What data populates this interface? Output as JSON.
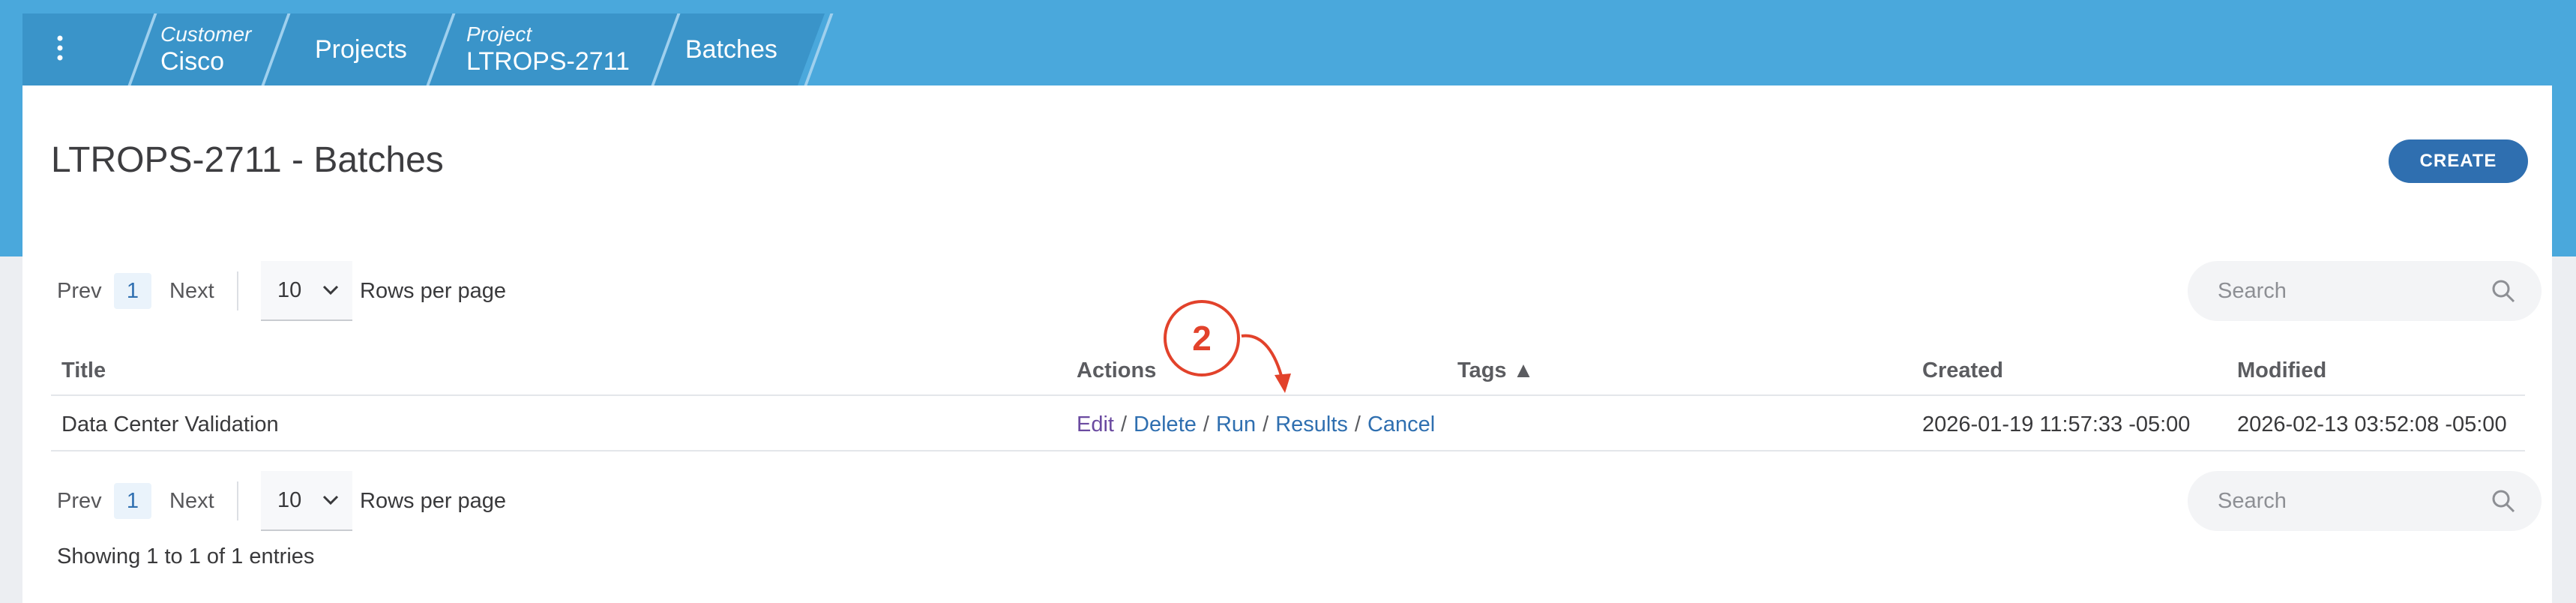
{
  "breadcrumb": {
    "menu_icon": "kebab-icon",
    "customer_label": "Customer",
    "customer_value": "Cisco",
    "projects": "Projects",
    "project_label": "Project",
    "project_value": "LTROPS-2711",
    "batches": "Batches"
  },
  "page": {
    "title": "LTROPS-2711 - Batches",
    "create_label": "CREATE"
  },
  "pager": {
    "prev": "Prev",
    "page": "1",
    "next": "Next",
    "rows_value": "10",
    "rows_label": "Rows per page",
    "search_placeholder": "Search"
  },
  "table": {
    "columns": {
      "title": "Title",
      "actions": "Actions",
      "tags": "Tags ▲",
      "created": "Created",
      "modified": "Modified"
    },
    "rows": [
      {
        "title": "Data Center Validation",
        "actions": [
          "Edit",
          "Delete",
          "Run",
          "Results",
          "Cancel"
        ],
        "tags": "",
        "created": "2026-01-19 11:57:33 -05:00",
        "modified": "2026-02-13 03:52:08 -05:00"
      }
    ]
  },
  "footer": {
    "info": "Showing 1 to 1 of 1 entries"
  },
  "annotation": {
    "number": "2"
  },
  "colors": {
    "header_blue": "#4aa8dc",
    "crumb_blue": "#3a94c9",
    "accent": "#2f6fb0",
    "annotation_red": "#e2422b"
  }
}
